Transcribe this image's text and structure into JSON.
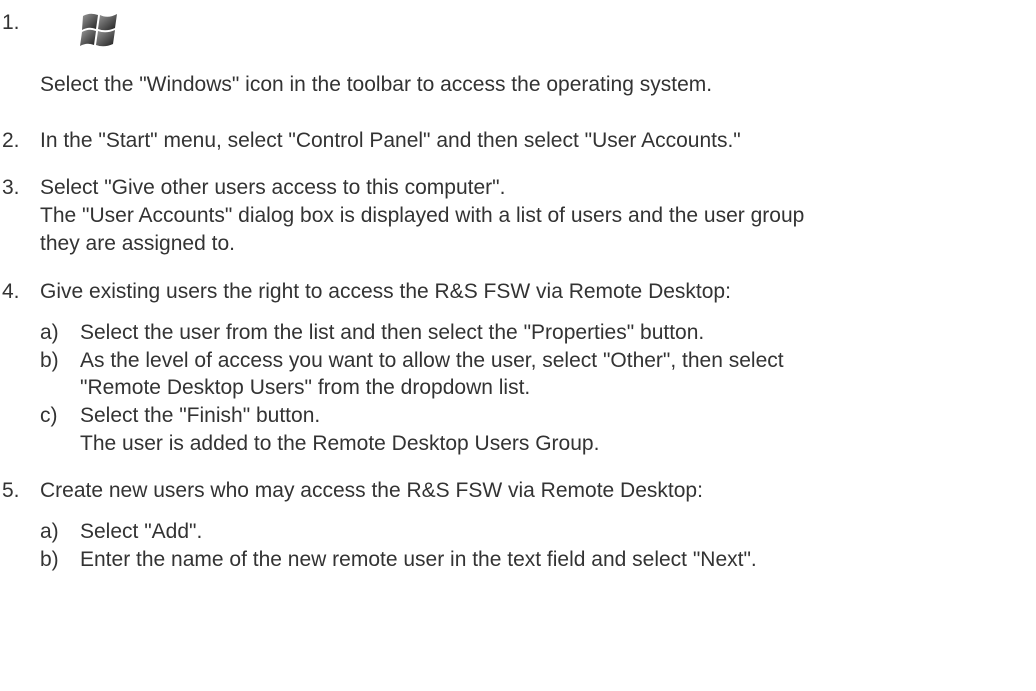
{
  "steps": [
    {
      "num": "1.",
      "icon": "windows-logo-icon",
      "text": "Select the \"Windows\" icon in the toolbar to access the operating system."
    },
    {
      "num": "2.",
      "text": "In the \"Start\" menu, select \"Control Panel\" and then select \"User Accounts.\""
    },
    {
      "num": "3.",
      "text": "Select \"Give other users access to this computer\".",
      "result_lines": [
        "The \"User Accounts\" dialog box is displayed with a list of users and the user group",
        "they are assigned to."
      ]
    },
    {
      "num": "4.",
      "text": "Give existing users the right to access the R&S FSW via Remote Desktop:",
      "substeps": [
        {
          "letter": "a)",
          "lines": [
            "Select the user from the list and then select the \"Properties\" button."
          ]
        },
        {
          "letter": "b)",
          "lines": [
            "As the level of access you want to allow the user, select \"Other\", then select",
            "\"Remote Desktop Users\" from the dropdown list."
          ]
        },
        {
          "letter": "c)",
          "lines": [
            "Select the \"Finish\" button.",
            "The user is added to the Remote Desktop Users Group."
          ]
        }
      ]
    },
    {
      "num": "5.",
      "text": "Create new users who may access the R&S FSW via Remote Desktop:",
      "substeps": [
        {
          "letter": "a)",
          "lines": [
            "Select \"Add\"."
          ]
        },
        {
          "letter": "b)",
          "lines": [
            "Enter the name of the new remote user in the text field and select \"Next\"."
          ]
        }
      ]
    }
  ]
}
